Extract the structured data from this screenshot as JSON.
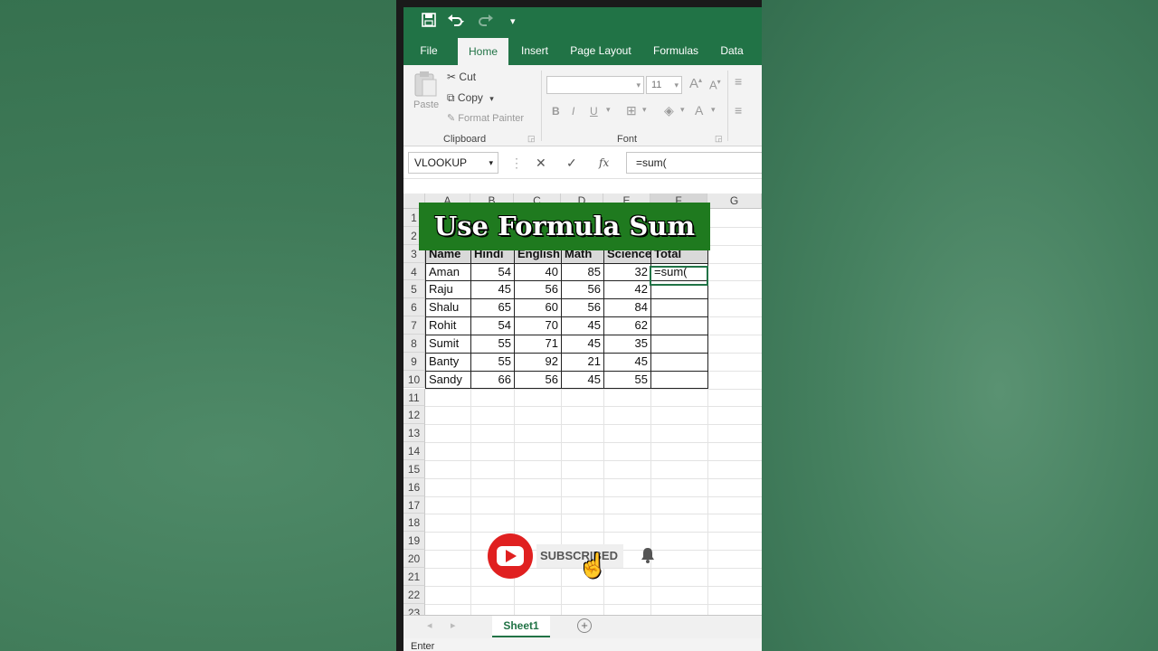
{
  "quick_access": {
    "save_icon": "save-icon",
    "undo_icon": "undo-icon",
    "redo_icon": "redo-icon",
    "customize": "▾"
  },
  "tabs": [
    "File",
    "Home",
    "Insert",
    "Page Layout",
    "Formulas",
    "Data"
  ],
  "active_tab": "Home",
  "ribbon": {
    "clipboard": {
      "paste": "Paste",
      "cut": "Cut",
      "copy": "Copy",
      "format_painter": "Format Painter",
      "label": "Clipboard"
    },
    "font": {
      "size": "11",
      "bold": "B",
      "italic": "I",
      "underline": "U",
      "grow": "A",
      "shrink": "A",
      "color": "A",
      "label": "Font"
    }
  },
  "formula_bar": {
    "name_box": "VLOOKUP",
    "cancel": "✕",
    "enter": "✓",
    "fx": "fx",
    "value": "=sum("
  },
  "columns": [
    "A",
    "B",
    "C",
    "D",
    "E",
    "F",
    "G"
  ],
  "rows": [
    "1",
    "2",
    "3",
    "4",
    "5",
    "6",
    "7",
    "8",
    "9",
    "10",
    "11",
    "12",
    "13",
    "14",
    "15",
    "16",
    "17",
    "18",
    "19",
    "20",
    "21",
    "22",
    "23"
  ],
  "table": {
    "headers": [
      "Name",
      "Hindi",
      "English",
      "Math",
      "Science",
      "Total"
    ],
    "rows": [
      [
        "Aman",
        "54",
        "40",
        "85",
        "32",
        "=sum("
      ],
      [
        "Raju",
        "45",
        "56",
        "56",
        "42",
        ""
      ],
      [
        "Shalu",
        "65",
        "60",
        "56",
        "84",
        ""
      ],
      [
        "Rohit",
        "54",
        "70",
        "45",
        "62",
        ""
      ],
      [
        "Sumit",
        "55",
        "71",
        "45",
        "35",
        ""
      ],
      [
        "Banty",
        "55",
        "92",
        "21",
        "45",
        ""
      ],
      [
        "Sandy",
        "66",
        "56",
        "45",
        "55",
        ""
      ]
    ]
  },
  "banner_text": "Use Formula Sum",
  "subscribe": {
    "label": "SUBSCRIBED"
  },
  "sheet_tab": "Sheet1",
  "status": "Enter",
  "colors": {
    "excel_green": "#217346",
    "banner_green": "#1f7a1f",
    "youtube_red": "#e02020"
  }
}
